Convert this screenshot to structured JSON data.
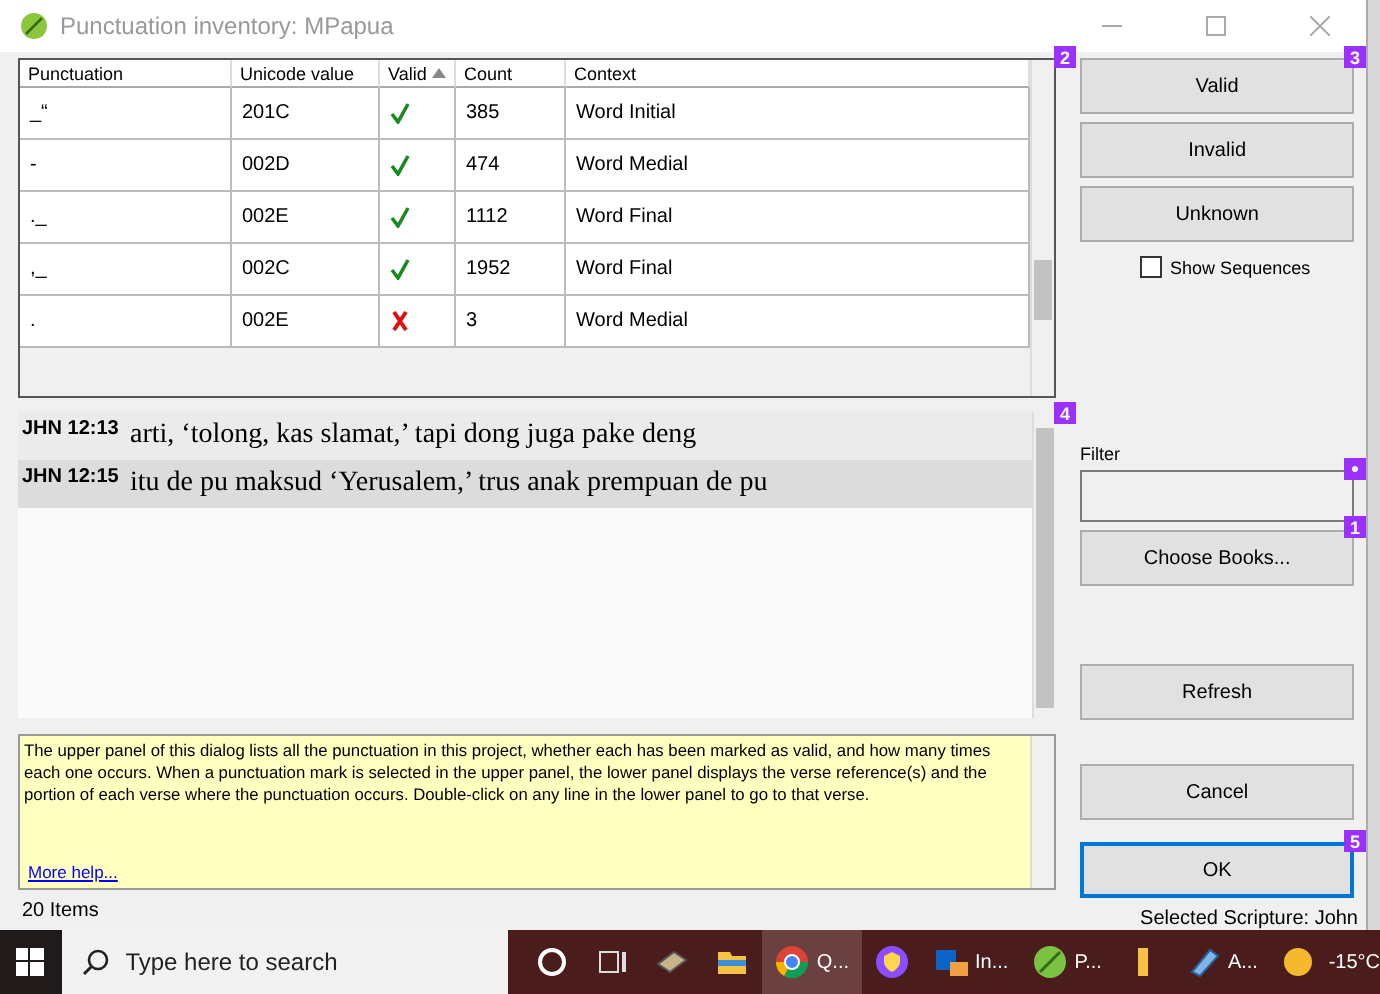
{
  "window": {
    "title": "Punctuation inventory: MPapua"
  },
  "table": {
    "columns": [
      {
        "label": "Punctuation",
        "sorted": false
      },
      {
        "label": "Unicode value",
        "sorted": false
      },
      {
        "label": "Valid",
        "sorted": true
      },
      {
        "label": "Count",
        "sorted": false
      },
      {
        "label": "Context",
        "sorted": false
      }
    ],
    "rows": [
      {
        "punctuation": "_“",
        "unicode": "201C",
        "valid": true,
        "count": "385",
        "context": "Word Initial"
      },
      {
        "punctuation": "-",
        "unicode": "002D",
        "valid": true,
        "count": "474",
        "context": "Word Medial"
      },
      {
        "punctuation": "._",
        "unicode": "002E",
        "valid": true,
        "count": "1112",
        "context": "Word Final"
      },
      {
        "punctuation": ",_",
        "unicode": "002C",
        "valid": true,
        "count": "1952",
        "context": "Word Final"
      },
      {
        "punctuation": ".",
        "unicode": "002E",
        "valid": false,
        "count": "3",
        "context": "Word Medial"
      }
    ]
  },
  "verses": [
    {
      "reference": "JHN 12:13",
      "text": "arti, ‘tolong, kas slamat,’ tapi dong juga pake deng",
      "selected": false
    },
    {
      "reference": "JHN 12:15",
      "text": "itu de pu maksud ‘Yerusalem,’ trus anak prempuan de pu",
      "selected": true
    }
  ],
  "help": {
    "text": "The upper panel of this dialog lists all the punctuation in this project, whether each has been marked as valid, and how many times each one occurs. When a punctuation mark is selected in the upper panel, the lower panel displays the verse reference(s) and the portion of each verse where the punctuation occurs. Double-click on any line in the lower panel to go to that verse.",
    "link": "More help..."
  },
  "status": "20 Items",
  "buttons_top": [
    {
      "label": "Valid",
      "focused": false
    },
    {
      "label": "Invalid",
      "focused": false
    },
    {
      "label": "Unknown",
      "focused": false
    }
  ],
  "show_sequences": {
    "label": "Show Sequences",
    "checked": false
  },
  "filter": {
    "label": "Filter"
  },
  "buttons_bottom": [
    {
      "label": "Choose Books...",
      "focused": false
    },
    {
      "label": "Refresh",
      "focused": false
    },
    {
      "label": "Cancel",
      "focused": false
    },
    {
      "label": "OK",
      "focused": true
    }
  ],
  "selected_scripture": "Selected Scripture: John",
  "annotations": [
    {
      "kind": "number",
      "label": "2"
    },
    {
      "kind": "number",
      "label": "3"
    },
    {
      "kind": "number",
      "label": "4"
    },
    {
      "kind": "dot"
    },
    {
      "kind": "number",
      "label": "1"
    },
    {
      "kind": "number",
      "label": "5"
    }
  ],
  "taskbar": {
    "search_placeholder": "Type here to search",
    "apps": [
      {
        "kind": "circle",
        "selected": false
      },
      {
        "kind": "taskview",
        "selected": false
      },
      {
        "kind": "book",
        "selected": false
      },
      {
        "kind": "folder",
        "selected": false
      },
      {
        "kind": "chrome",
        "label": "Q...",
        "selected": true
      },
      {
        "kind": "shield",
        "selected": false
      },
      {
        "kind": "mail",
        "label": "In...",
        "selected": false
      },
      {
        "kind": "leaf",
        "label": "P...",
        "selected": false
      },
      {
        "kind": "file",
        "selected": false
      },
      {
        "kind": "notepad",
        "label": "A...",
        "selected": false
      }
    ],
    "weather": "-15°C"
  }
}
